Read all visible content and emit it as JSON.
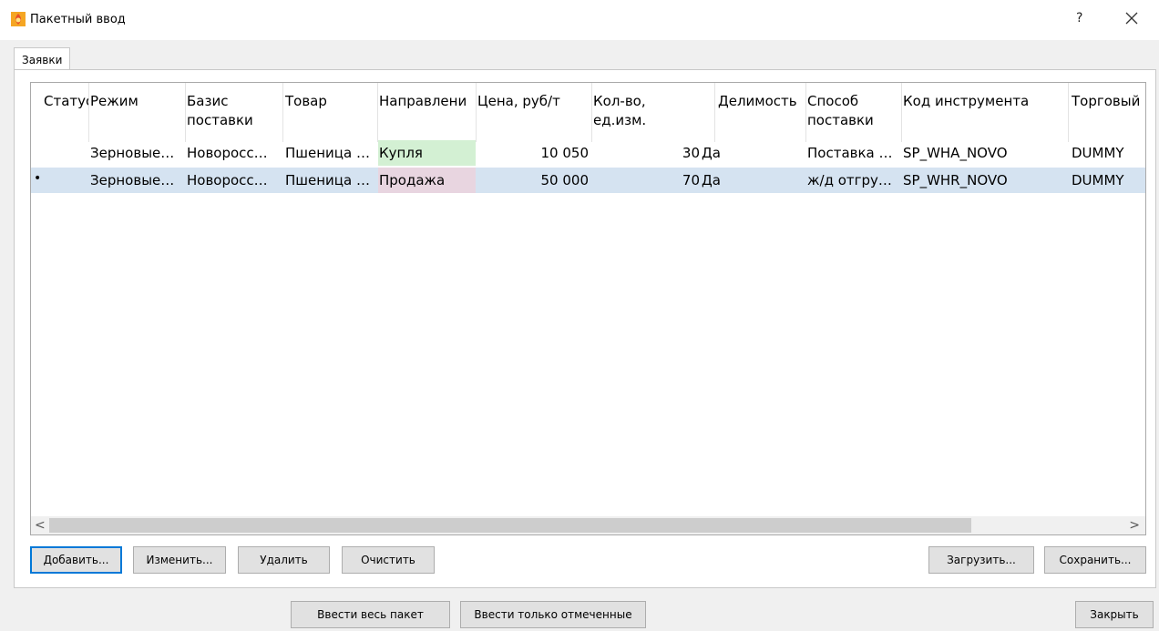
{
  "window": {
    "title": "Пакетный ввод",
    "help_label": "?",
    "app_icon": "flame-logo-icon",
    "close_icon": "close-icon"
  },
  "tabs": [
    {
      "label": "Заявки"
    }
  ],
  "grid": {
    "columns": [
      "Статус",
      "Режим",
      "Базис поставки",
      "Товар",
      "Направление",
      "Цена, руб/т",
      "Кол-во, ед.изм.",
      "Делимость",
      "Способ поставки",
      "Код инструмента",
      "Торговый"
    ],
    "header_lines": {
      "status": "Статус",
      "mode": "Режим",
      "basis_1": "Базис",
      "basis_2": "поставки",
      "product": "Товар",
      "direction": "Направлени",
      "price": "Цена, руб/т",
      "qty_1": "Кол-во,",
      "qty_2": "ед.изм.",
      "divisibility": "Делимость",
      "delivery_1": "Способ",
      "delivery_2": "поставки",
      "instrument": "Код инструмента",
      "trading": "Торговый"
    },
    "rows": [
      {
        "status": "",
        "mode": "Зерновые…",
        "basis": "Новоросс…",
        "product": "Пшеница …",
        "direction": "Купля",
        "price": "10 050",
        "qty": "30",
        "divisibility": "Да",
        "delivery": "Поставка …",
        "instrument": "SP_WHA_NOVO",
        "trading": "DUMMY",
        "direction_color": "#d3f0d3",
        "selected": false
      },
      {
        "status": "",
        "marker": "•",
        "mode": "Зерновые…",
        "basis": "Новоросс…",
        "product": "Пшеница …",
        "direction": "Продажа",
        "price": "50 000",
        "qty": "70",
        "divisibility": "Да",
        "delivery": "ж/д отгру…",
        "instrument": "SP_WHR_NOVO",
        "trading": "DUMMY",
        "direction_color": "#e8d5e0",
        "selected": true
      }
    ]
  },
  "buttons": {
    "add": "Добавить...",
    "edit": "Изменить...",
    "delete": "Удалить",
    "clear": "Очистить",
    "load": "Загрузить...",
    "save": "Сохранить...",
    "submit_all": "Ввести весь пакет",
    "submit_marked": "Ввести только отмеченные",
    "close": "Закрыть"
  },
  "scrollbar": {
    "left_arrow": "<",
    "right_arrow": ">"
  }
}
